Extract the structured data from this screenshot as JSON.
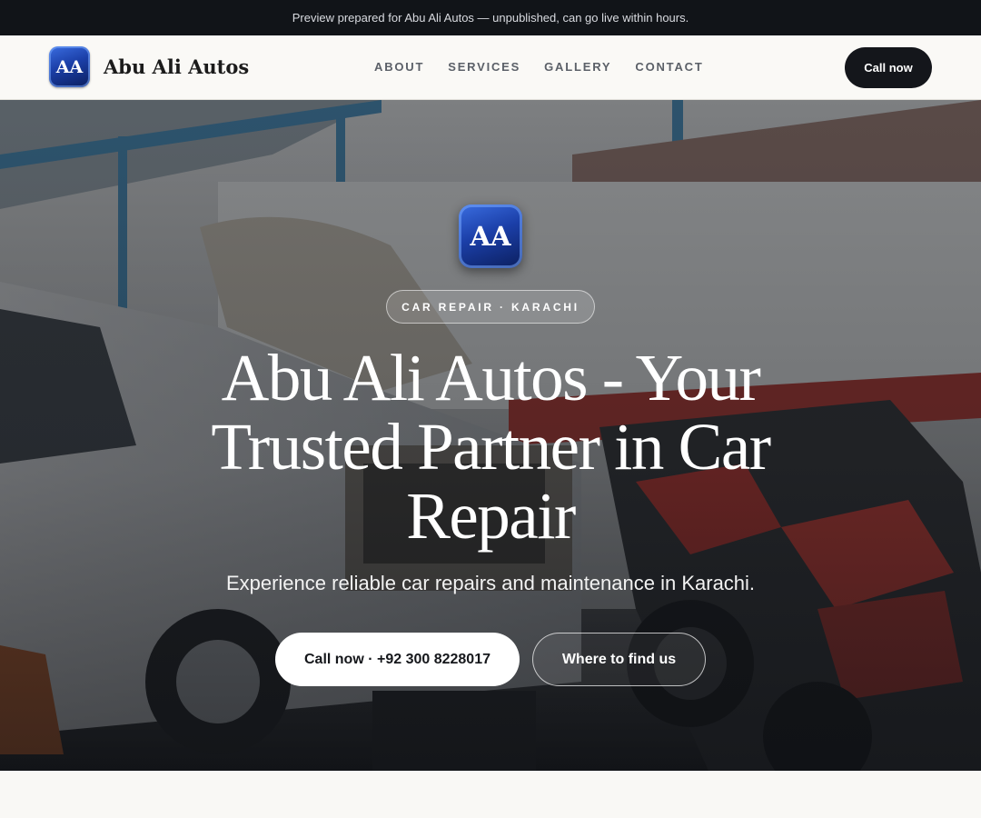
{
  "preview_banner": "Preview prepared for Abu Ali Autos — unpublished, can go live within hours.",
  "header": {
    "logo_initials": "AA",
    "brand": "Abu Ali Autos",
    "nav": [
      {
        "label": "ABOUT"
      },
      {
        "label": "SERVICES"
      },
      {
        "label": "GALLERY"
      },
      {
        "label": "CONTACT"
      }
    ],
    "cta_label": "Call now"
  },
  "hero": {
    "badge_initials": "AA",
    "eyebrow": "CAR REPAIR · KARACHI",
    "title": "Abu Ali Autos - Your Trusted Partner in Car Repair",
    "subtitle": "Experience reliable car repairs and maintenance in Karachi.",
    "primary_cta": "Call now · +92 300 8228017",
    "secondary_cta": "Where to find us"
  },
  "colors": {
    "dark": "#14161b",
    "badge_blue": "#1b3fa8",
    "page_bg": "#f9f8f5"
  }
}
